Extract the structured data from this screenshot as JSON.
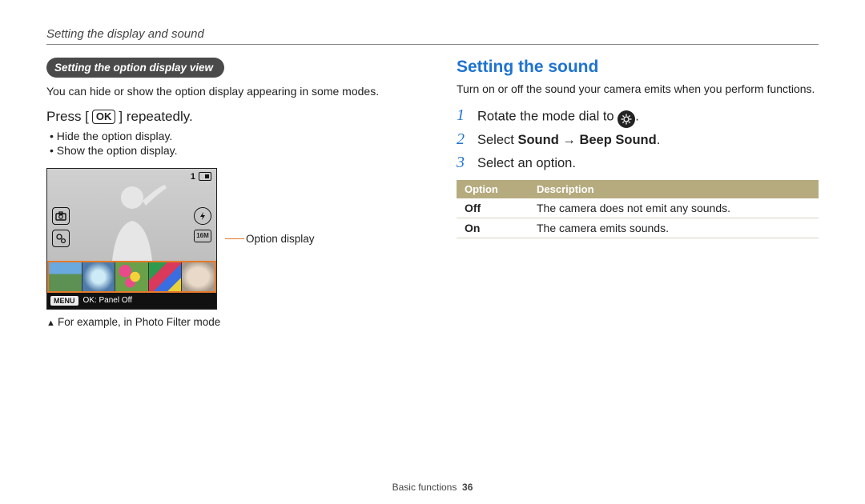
{
  "header": "Setting the display and sound",
  "left": {
    "pill": "Setting the option display view",
    "intro": "You can hide or show the option display appearing in some modes.",
    "instruction_pre": "Press [",
    "ok": "OK",
    "instruction_post": "] repeatedly.",
    "bullets": [
      "Hide the option display.",
      "Show the option display."
    ],
    "screen": {
      "status_num": "1",
      "menu_label": "MENU",
      "bottom_text": "OK: Panel Off"
    },
    "callout": "Option display",
    "caption": "For example, in Photo Filter mode"
  },
  "right": {
    "heading": "Setting the sound",
    "intro": "Turn on or off the sound your camera emits when you perform functions.",
    "steps": {
      "s1_pre": "Rotate the mode dial to ",
      "s1_post": ".",
      "s2_pre": "Select ",
      "s2_b1": "Sound",
      "s2_arrow": " → ",
      "s2_b2": "Beep Sound",
      "s2_post": ".",
      "s3": "Select an option."
    },
    "table": {
      "h1": "Option",
      "h2": "Description",
      "rows": [
        {
          "opt": "Off",
          "desc": "The camera does not emit any sounds."
        },
        {
          "opt": "On",
          "desc": "The camera emits sounds."
        }
      ]
    }
  },
  "footer": {
    "section": "Basic functions",
    "page": "36"
  }
}
